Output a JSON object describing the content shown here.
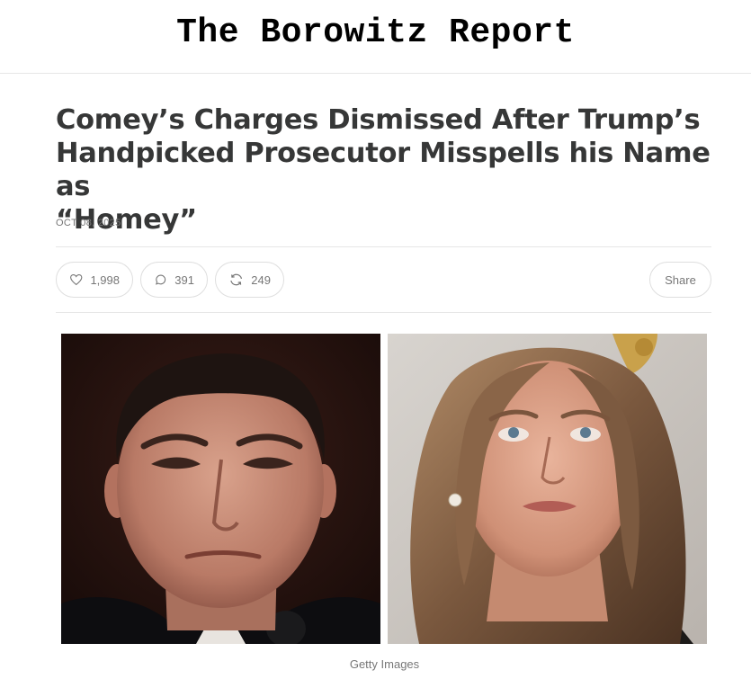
{
  "publication": {
    "name": "The Borowitz Report"
  },
  "article": {
    "title_lines": [
      "Comey’s Charges Dismissed After Trump’s",
      "Handpicked Prosecutor Misspells his Name as",
      "“Homey”"
    ],
    "date": "OCT 08, 2025"
  },
  "actions": {
    "likes": "1,998",
    "comments": "391",
    "restacks": "249",
    "share_label": "Share"
  },
  "image": {
    "caption": "Getty Images"
  },
  "icons": [
    "heart-icon",
    "comment-icon",
    "restack-icon"
  ]
}
